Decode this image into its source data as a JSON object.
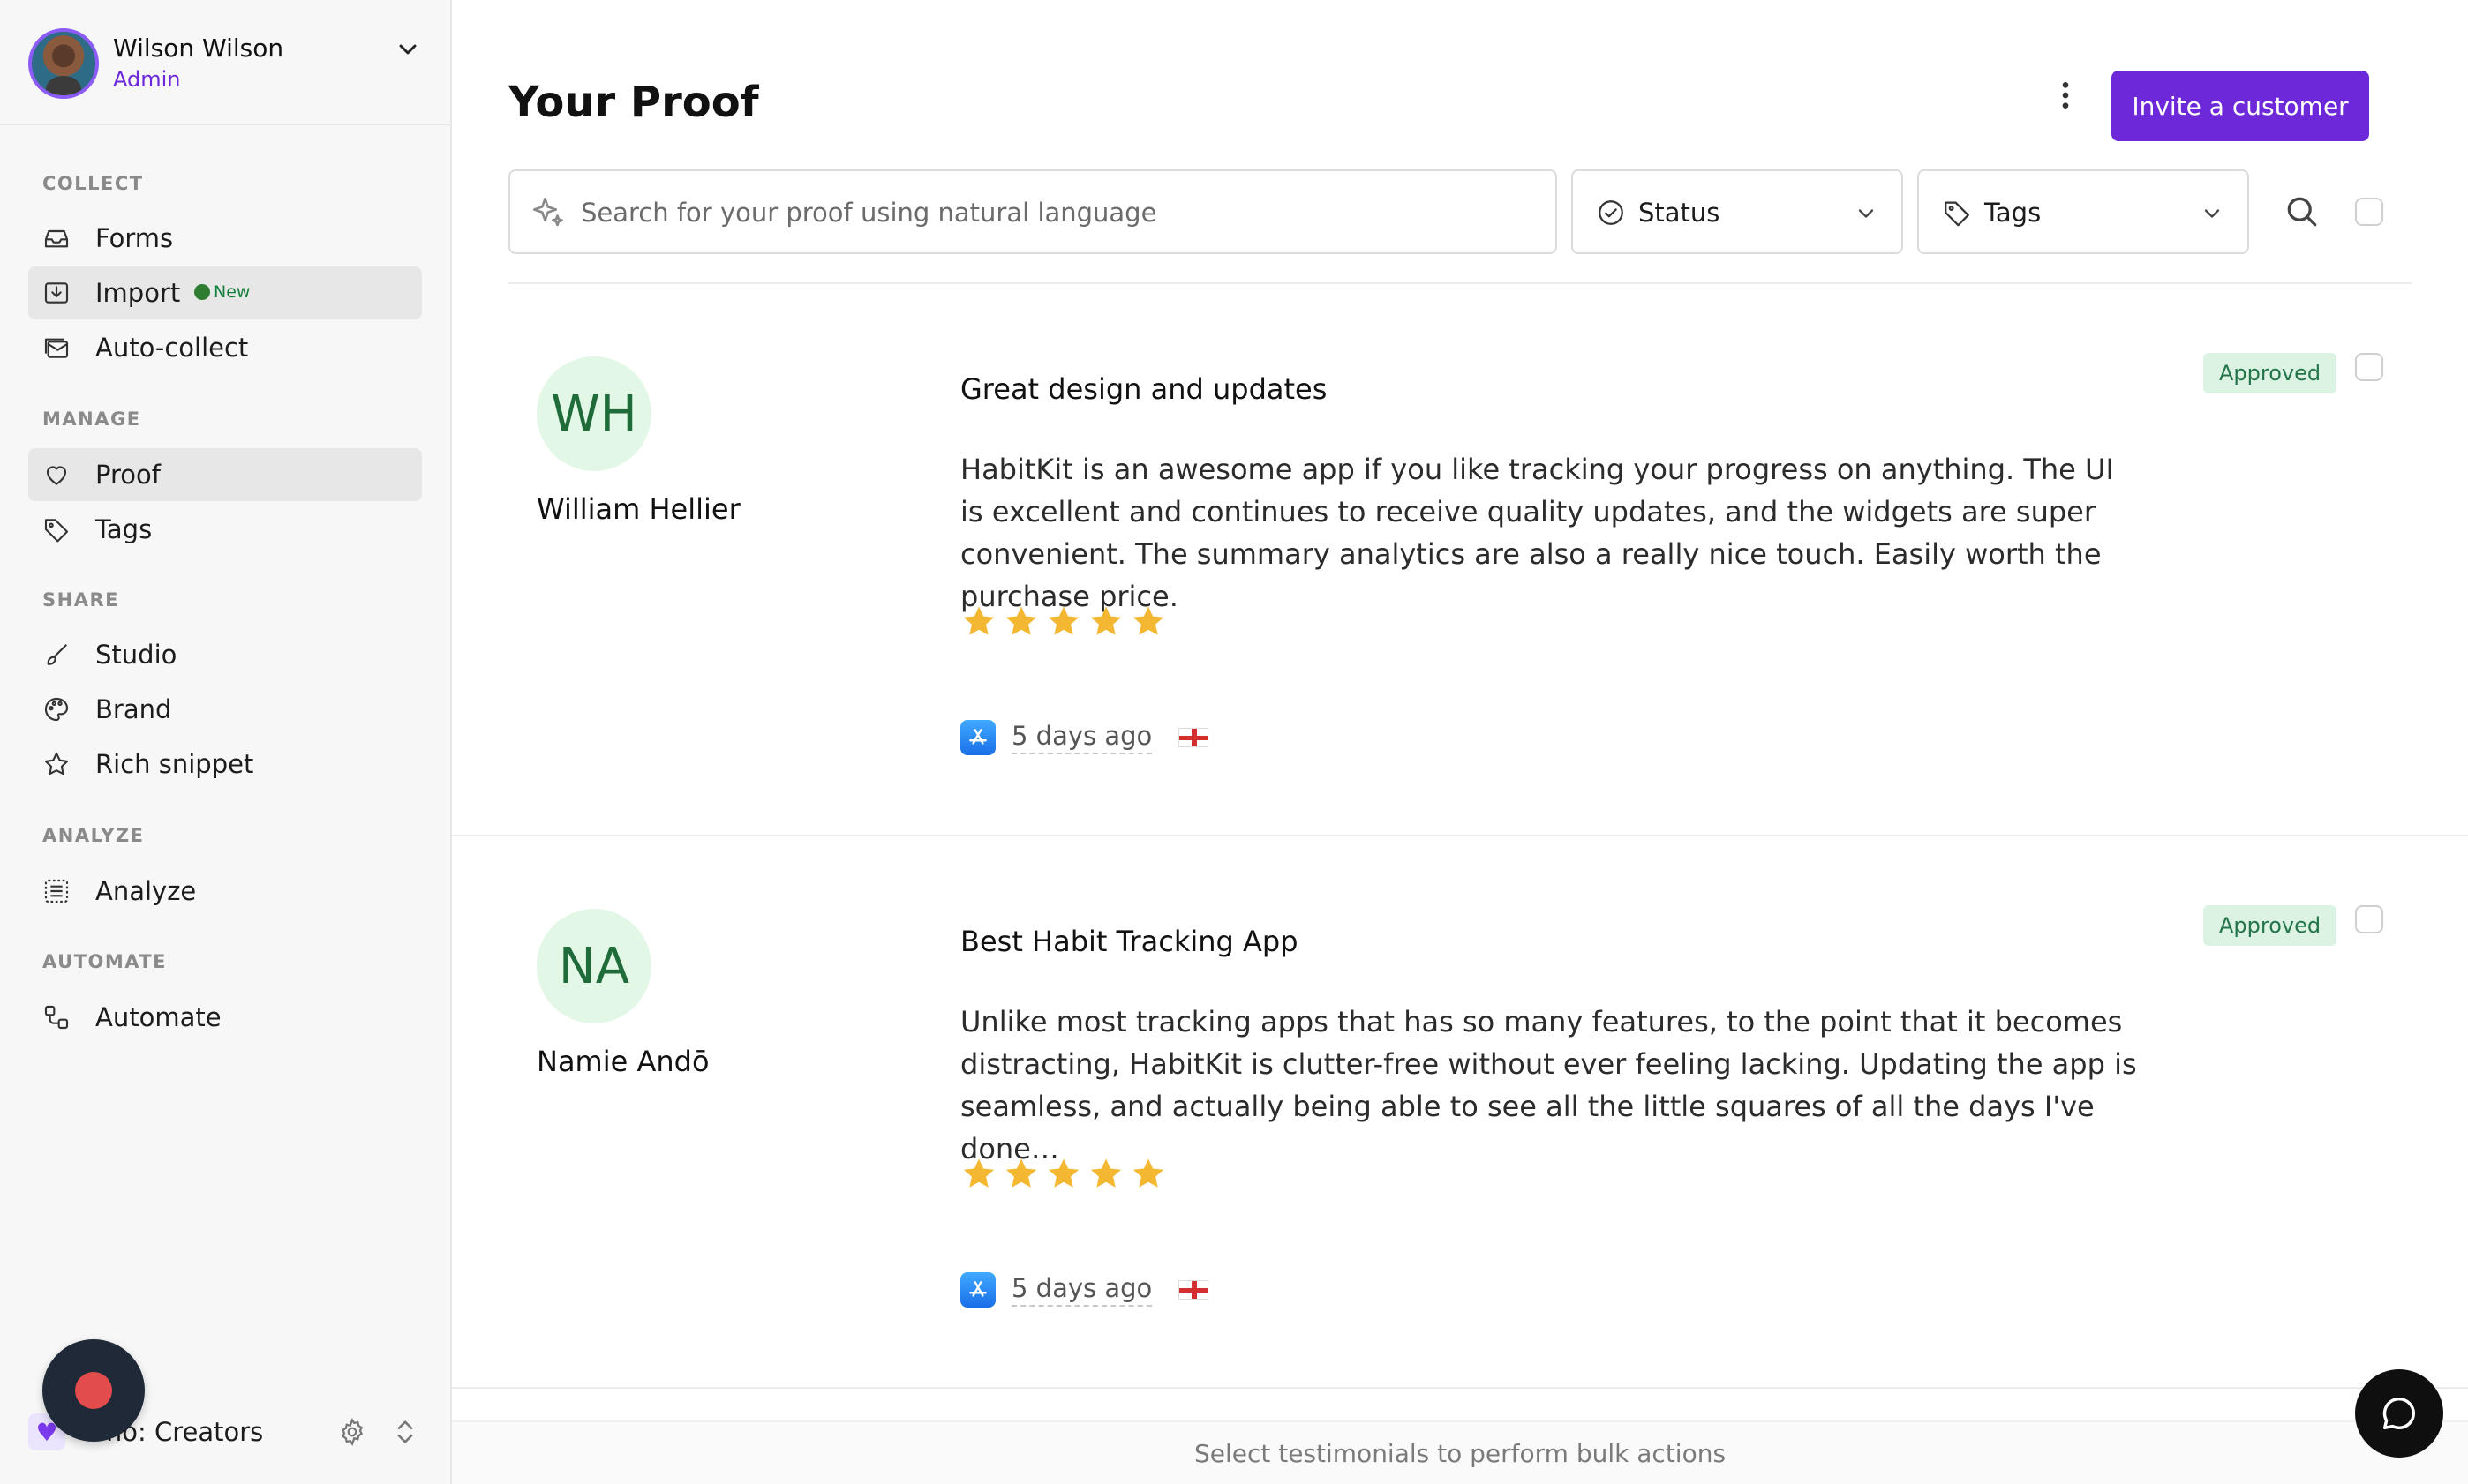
{
  "user": {
    "name": "Wilson Wilson",
    "role": "Admin"
  },
  "sidebar": {
    "sections": {
      "collect": "COLLECT",
      "manage": "MANAGE",
      "share": "SHARE",
      "analyze": "ANALYZE",
      "automate": "AUTOMATE"
    },
    "items": {
      "forms": "Forms",
      "import": "Import",
      "import_badge": "New",
      "auto_collect": "Auto-collect",
      "proof": "Proof",
      "tags": "Tags",
      "studio": "Studio",
      "brand": "Brand",
      "rich_snippet": "Rich snippet",
      "analyze": "Analyze",
      "automate": "Automate"
    },
    "workspace": {
      "name": "mo: Creators",
      "icon": "heart-icon"
    }
  },
  "header": {
    "title": "Your Proof",
    "invite_label": "Invite a customer"
  },
  "filters": {
    "search_placeholder": "Search for your proof using natural language",
    "status_label": "Status",
    "tags_label": "Tags"
  },
  "testimonials": [
    {
      "initials": "WH",
      "author": "William Hellier",
      "title": "Great design and updates",
      "body": "HabitKit is an awesome app if you like tracking your progress on anything. The UI is excellent and continues to receive quality updates, and the widgets are super convenient. The summary analytics are also a really nice touch. Easily worth the purchase price.",
      "rating": 5,
      "time": "5 days ago",
      "source_icon": "app-store-icon",
      "flag": "england-flag",
      "status": "Approved"
    },
    {
      "initials": "NA",
      "author": "Namie Andō",
      "title": "Best Habit Tracking App",
      "body": "Unlike most tracking apps that has so many features, to the point that it becomes distracting, HabitKit is clutter-free without ever feeling lacking. Updating the app is seamless, and actually being able to see all the little squares of all the days I've done…",
      "rating": 5,
      "time": "5 days ago",
      "source_icon": "app-store-icon",
      "flag": "england-flag",
      "status": "Approved"
    }
  ],
  "bulk_bar": {
    "text": "Select testimonials to perform bulk actions"
  },
  "colors": {
    "accent": "#6d28d9",
    "approved_bg": "#dcf2e2",
    "approved_text": "#24754a",
    "star": "#f4b731"
  }
}
